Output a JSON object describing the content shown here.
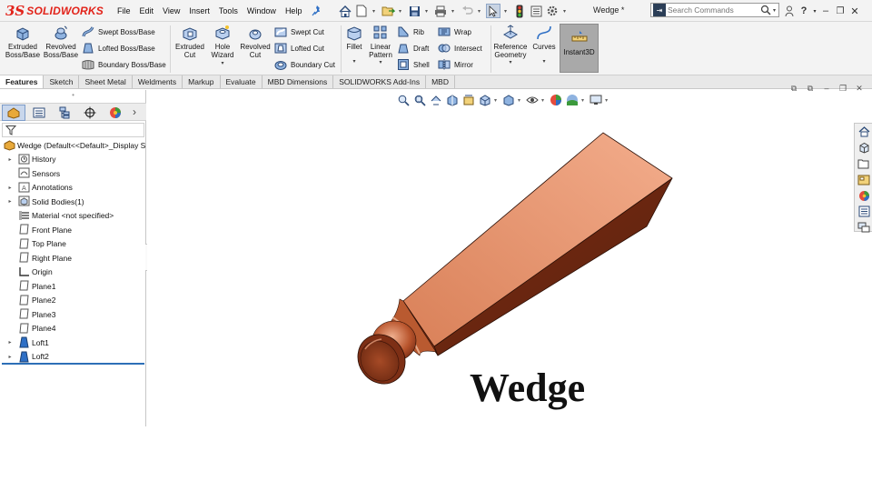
{
  "app": {
    "logo_ds": "3S",
    "logo_name": "SOLIDWORKS",
    "brand_color": "#e2231a",
    "document_title": "Wedge *"
  },
  "menu": [
    "File",
    "Edit",
    "View",
    "Insert",
    "Tools",
    "Window",
    "Help"
  ],
  "search": {
    "placeholder": "Search Commands"
  },
  "command_manager": {
    "extruded_boss": "Extruded\nBoss/Base",
    "revolved_boss": "Revolved\nBoss/Base",
    "swept_boss": "Swept Boss/Base",
    "lofted_boss": "Lofted Boss/Base",
    "boundary_boss": "Boundary Boss/Base",
    "extruded_cut": "Extruded\nCut",
    "hole_wizard": "Hole\nWizard",
    "revolved_cut": "Revolved\nCut",
    "swept_cut": "Swept Cut",
    "lofted_cut": "Lofted Cut",
    "boundary_cut": "Boundary Cut",
    "fillet": "Fillet",
    "linear_pattern": "Linear\nPattern",
    "rib": "Rib",
    "draft": "Draft",
    "shell": "Shell",
    "wrap": "Wrap",
    "intersect": "Intersect",
    "mirror": "Mirror",
    "reference_geometry": "Reference\nGeometry",
    "curves": "Curves",
    "instant3d": "Instant3D"
  },
  "tabs": [
    "Features",
    "Sketch",
    "Sheet Metal",
    "Weldments",
    "Markup",
    "Evaluate",
    "MBD Dimensions",
    "SOLIDWORKS Add-Ins",
    "MBD"
  ],
  "active_tab": "Features",
  "feature_tree": [
    {
      "label": "Wedge  (Default<<Default>_Display S",
      "icon": "part-icon",
      "expandable": false,
      "level": 0
    },
    {
      "label": "History",
      "icon": "history-folder-icon",
      "expandable": true,
      "level": 1
    },
    {
      "label": "Sensors",
      "icon": "sensors-folder-icon",
      "expandable": false,
      "level": 1
    },
    {
      "label": "Annotations",
      "icon": "annotations-folder-icon",
      "expandable": true,
      "level": 1
    },
    {
      "label": "Solid Bodies(1)",
      "icon": "solid-bodies-folder-icon",
      "expandable": true,
      "level": 1
    },
    {
      "label": "Material <not specified>",
      "icon": "material-icon",
      "expandable": false,
      "level": 1
    },
    {
      "label": "Front Plane",
      "icon": "plane-icon",
      "expandable": false,
      "level": 1
    },
    {
      "label": "Top Plane",
      "icon": "plane-icon",
      "expandable": false,
      "level": 1
    },
    {
      "label": "Right Plane",
      "icon": "plane-icon",
      "expandable": false,
      "level": 1
    },
    {
      "label": "Origin",
      "icon": "origin-icon",
      "expandable": false,
      "level": 1
    },
    {
      "label": "Plane1",
      "icon": "plane-icon",
      "expandable": false,
      "level": 1
    },
    {
      "label": "Plane2",
      "icon": "plane-icon",
      "expandable": false,
      "level": 1
    },
    {
      "label": "Plane3",
      "icon": "plane-icon",
      "expandable": false,
      "level": 1
    },
    {
      "label": "Plane4",
      "icon": "plane-icon",
      "expandable": false,
      "level": 1
    },
    {
      "label": "Loft1",
      "icon": "loft-icon",
      "expandable": true,
      "level": 1
    },
    {
      "label": "Loft2",
      "icon": "loft-icon",
      "expandable": true,
      "level": 1
    }
  ],
  "graphics": {
    "overlay_title": "Wedge",
    "model_color": "#d9845f"
  }
}
